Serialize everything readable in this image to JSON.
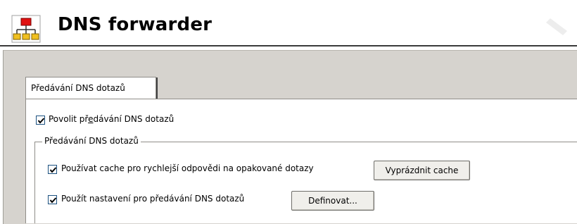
{
  "header": {
    "title": "DNS forwarder",
    "icon": "network-tree-icon"
  },
  "tabs": [
    {
      "label": "Předávání DNS dotazů",
      "selected": true
    }
  ],
  "main": {
    "enable_forwarding": {
      "label_pre": "Povolit př",
      "label_accel": "e",
      "label_post": "dávání DNS dotazů",
      "checked": true
    },
    "group": {
      "legend": "Předávání DNS dotazů",
      "use_cache": {
        "label": "Používat cache pro rychlejší odpovědi na opakované dotazy",
        "checked": true
      },
      "clear_cache_button": "Vyprázdnit cache",
      "use_forward_settings": {
        "label": "Použít nastavení pro předávání DNS dotazů",
        "checked": true
      },
      "define_button": "Definovat..."
    }
  },
  "colors": {
    "panel_bg": "#d6d3ce",
    "content_bg": "#ffffff",
    "checkbox_border": "#1c5180",
    "icon_red": "#e01010",
    "icon_yellow": "#f0c020"
  }
}
